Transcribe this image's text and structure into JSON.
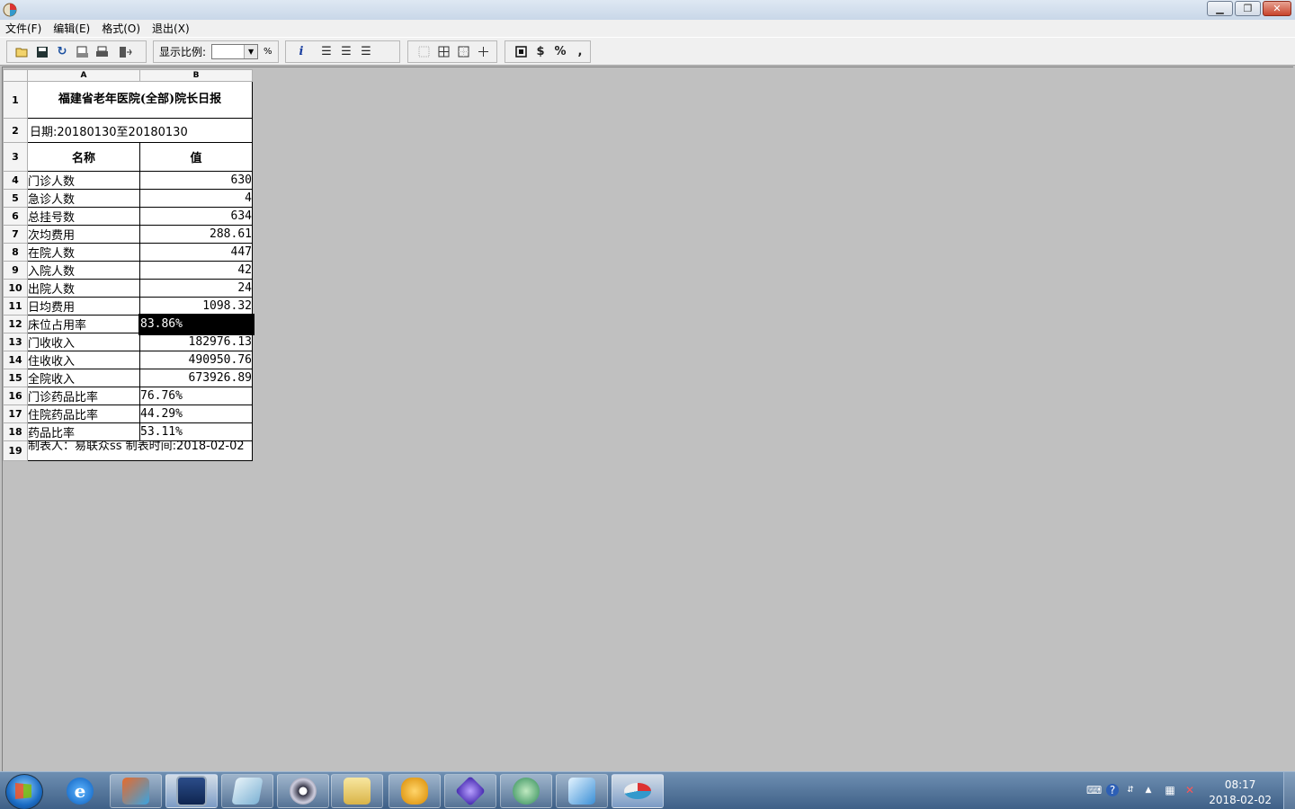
{
  "menu": [
    "文件(F)",
    "编辑(E)",
    "格式(O)",
    "退出(X)"
  ],
  "toolbar": {
    "zoom_label": "显示比例:",
    "zoom_value": "",
    "zoom_unit": "%",
    "format_currency": "$",
    "format_percent": "%",
    "format_comma": ","
  },
  "sheet": {
    "columns": [
      "A",
      "B"
    ],
    "title": "福建省老年医院(全部)院长日报",
    "date_line": "日期:20180130至20180130",
    "header": {
      "name": "名称",
      "value": "值"
    },
    "rows": [
      {
        "row": "4",
        "name": "门诊人数",
        "value": "630",
        "align": "num"
      },
      {
        "row": "5",
        "name": "急诊人数",
        "value": "4",
        "align": "num"
      },
      {
        "row": "6",
        "name": "总挂号数",
        "value": "634",
        "align": "num"
      },
      {
        "row": "7",
        "name": "次均费用",
        "value": "288.61",
        "align": "num"
      },
      {
        "row": "8",
        "name": "在院人数",
        "value": "447",
        "align": "num"
      },
      {
        "row": "9",
        "name": "入院人数",
        "value": "42",
        "align": "num"
      },
      {
        "row": "10",
        "name": "出院人数",
        "value": "24",
        "align": "num"
      },
      {
        "row": "11",
        "name": "日均费用",
        "value": "1098.32",
        "align": "num"
      },
      {
        "row": "12",
        "name": "床位占用率",
        "value": "83.86%",
        "align": "pctv",
        "selected": true
      },
      {
        "row": "13",
        "name": "门收收入",
        "value": "182976.13",
        "align": "num"
      },
      {
        "row": "14",
        "name": "住收收入",
        "value": "490950.76",
        "align": "num"
      },
      {
        "row": "15",
        "name": "全院收入",
        "value": "673926.89",
        "align": "num"
      },
      {
        "row": "16",
        "name": "门诊药品比率",
        "value": "76.76%",
        "align": "pctv"
      },
      {
        "row": "17",
        "name": "住院药品比率",
        "value": "44.29%",
        "align": "pctv"
      },
      {
        "row": "18",
        "name": "药品比率",
        "value": "53.11%",
        "align": "pctv"
      }
    ],
    "footer": "制表人：易联众ss  制表时间:2018-02-02"
  },
  "taskbar": {
    "clock_time": "08:17",
    "clock_date": "2018-02-02"
  },
  "colors": {
    "workspace": "#c0c0c0",
    "selection": "#000000",
    "taskbar": "#3e5f86"
  }
}
